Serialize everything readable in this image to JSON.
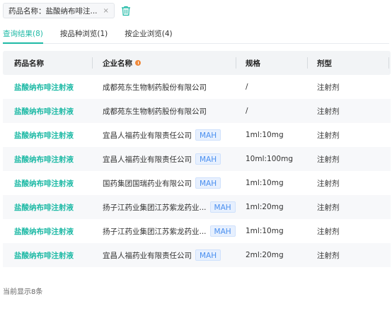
{
  "filter": {
    "tag_text": "药品名称：盐酸纳布啡注...",
    "close_glyph": "×"
  },
  "tabs": [
    {
      "label": "查询结果(8)"
    },
    {
      "label": "按品种浏览(1)"
    },
    {
      "label": "按企业浏览(4)"
    }
  ],
  "table": {
    "headers": {
      "drug": "药品名称",
      "company": "企业名称",
      "spec": "规格",
      "form": "剂型"
    },
    "rows": [
      {
        "drug": "盐酸纳布啡注射液",
        "company": "成都苑东生物制药股份有限公司",
        "mah": "",
        "spec": "/",
        "form": "注射剂"
      },
      {
        "drug": "盐酸纳布啡注射液",
        "company": "成都苑东生物制药股份有限公司",
        "mah": "",
        "spec": "/",
        "form": "注射剂"
      },
      {
        "drug": "盐酸纳布啡注射液",
        "company": "宜昌人福药业有限责任公司",
        "mah": "MAH",
        "spec": "1ml:10mg",
        "form": "注射剂"
      },
      {
        "drug": "盐酸纳布啡注射液",
        "company": "宜昌人福药业有限责任公司",
        "mah": "MAH",
        "spec": "10ml:100mg",
        "form": "注射剂"
      },
      {
        "drug": "盐酸纳布啡注射液",
        "company": "国药集团国瑞药业有限公司",
        "mah": "MAH",
        "spec": "1ml:10mg",
        "form": "注射剂"
      },
      {
        "drug": "盐酸纳布啡注射液",
        "company": "扬子江药业集团江苏紫龙药业...",
        "mah": "MAH",
        "spec": "1ml:20mg",
        "form": "注射剂"
      },
      {
        "drug": "盐酸纳布啡注射液",
        "company": "扬子江药业集团江苏紫龙药业...",
        "mah": "MAH",
        "spec": "1ml:10mg",
        "form": "注射剂"
      },
      {
        "drug": "盐酸纳布啡注射液",
        "company": "宜昌人福药业有限责任公司",
        "mah": "MAH",
        "spec": "2ml:20mg",
        "form": "注射剂"
      }
    ]
  },
  "footer": {
    "count_text": "当前显示8条"
  },
  "colors": {
    "accent": "#1fbaa6",
    "mah_blue": "#4a8ff0",
    "info_orange": "#f08a3c"
  },
  "icons": {
    "tag_close": "close-icon",
    "clear_filters": "trash-icon",
    "company_info": "info-icon"
  }
}
